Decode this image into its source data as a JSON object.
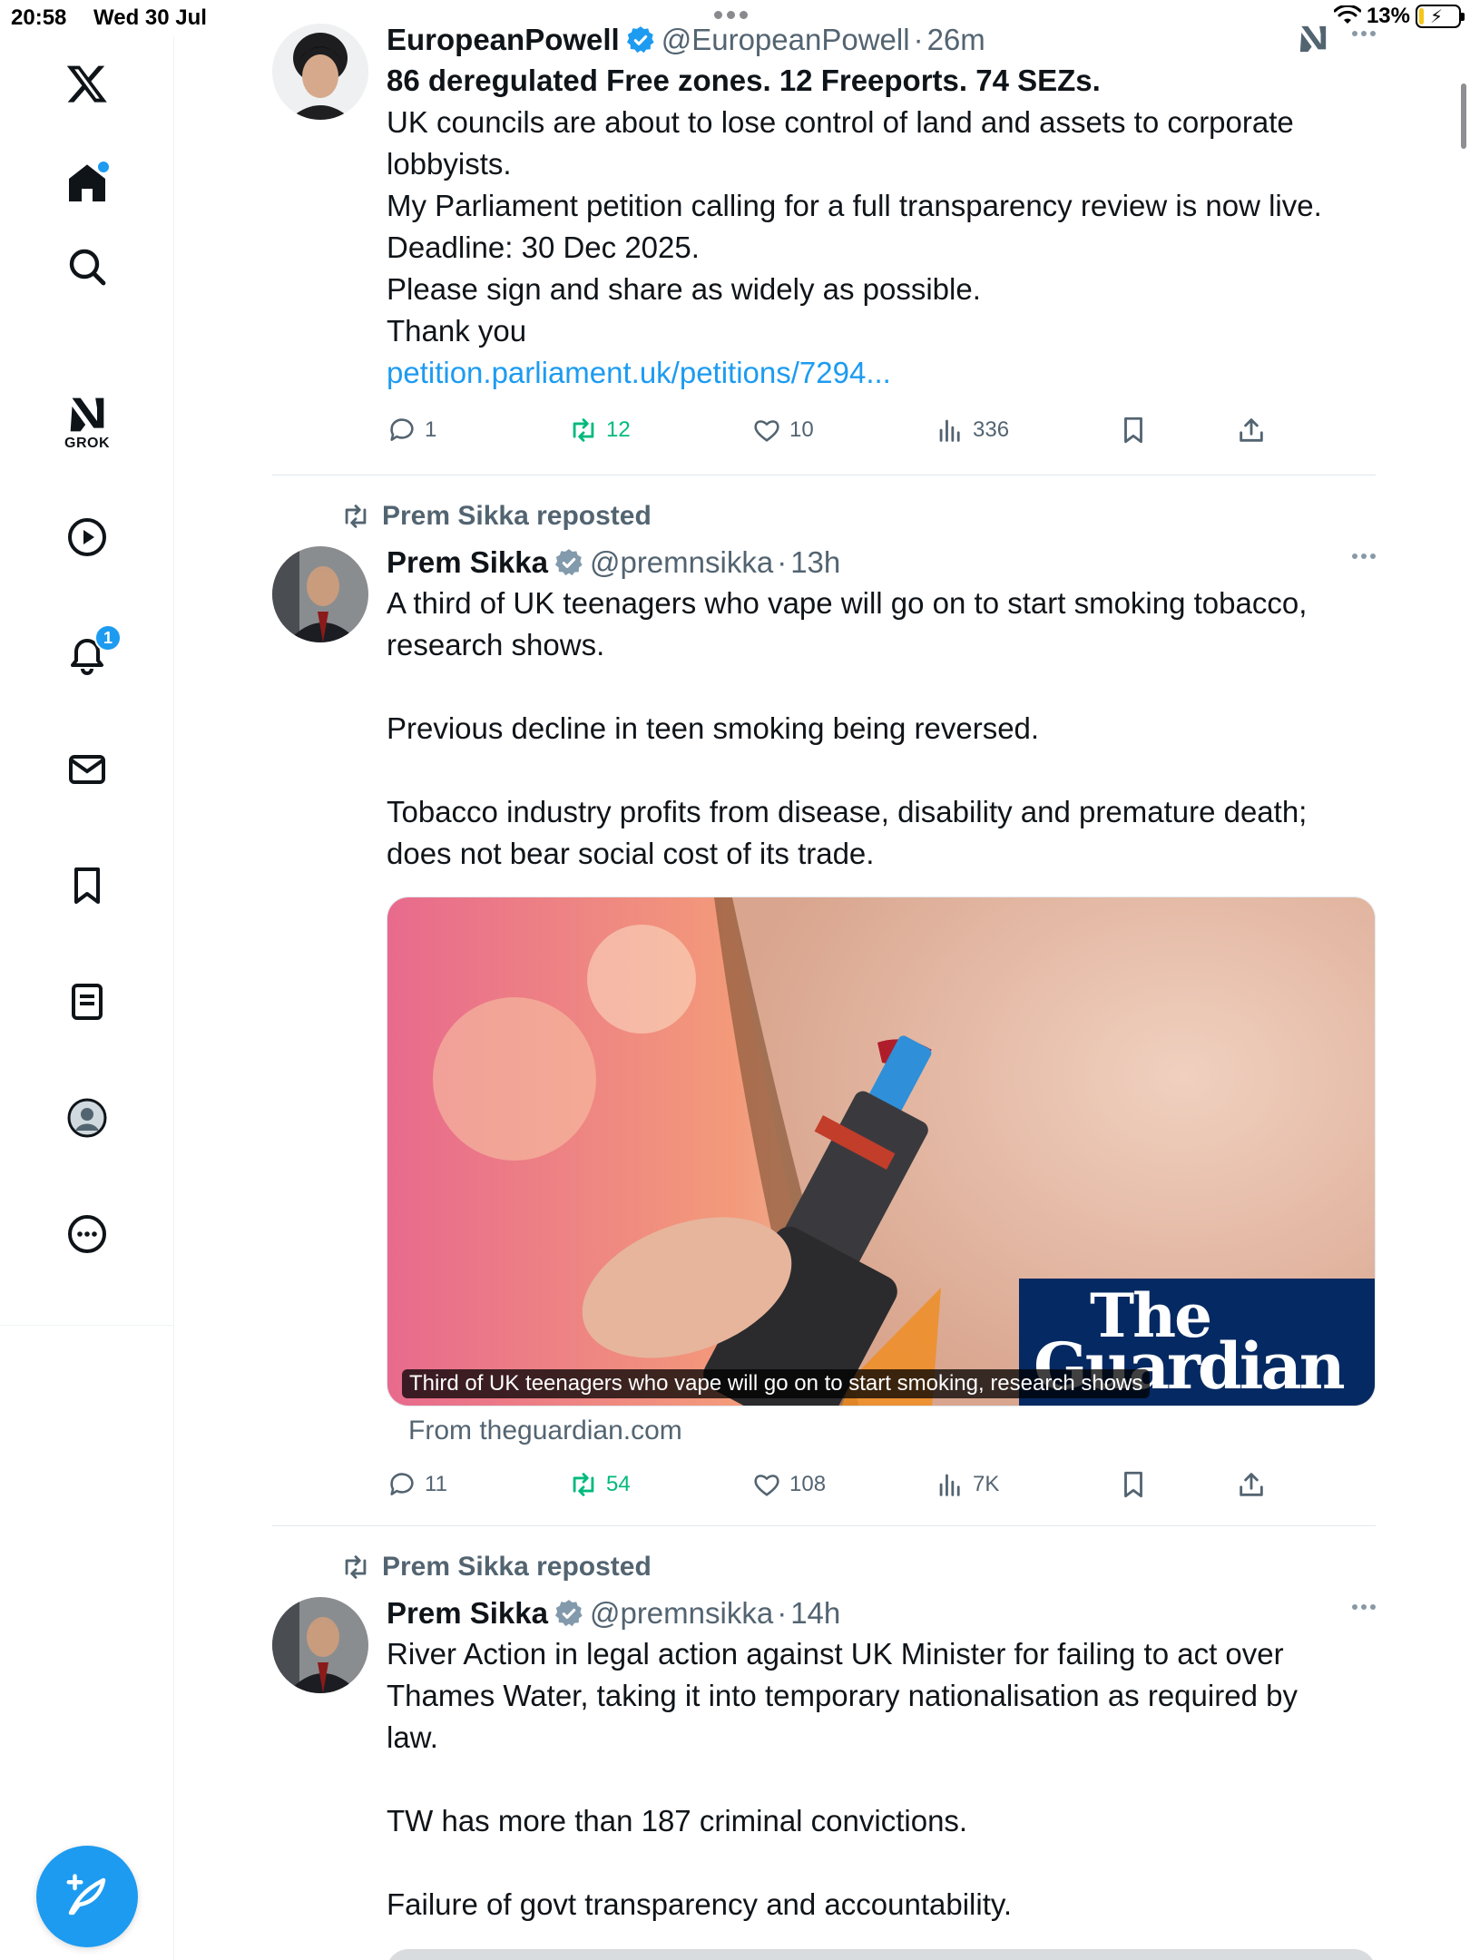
{
  "status_bar": {
    "time": "20:58",
    "date": "Wed 30 Jul",
    "battery_percent": "13%",
    "battery_level": 0.13
  },
  "sidebar": {
    "items": [
      {
        "name": "x-logo",
        "icon": "x-logo-icon"
      },
      {
        "name": "home",
        "icon": "home-icon",
        "has_dot": true
      },
      {
        "name": "search",
        "icon": "search-icon"
      },
      {
        "name": "grok",
        "icon": "grok-icon",
        "label": "GROK"
      },
      {
        "name": "video",
        "icon": "play-icon"
      },
      {
        "name": "notifications",
        "icon": "bell-icon",
        "badge": "1"
      },
      {
        "name": "messages",
        "icon": "mail-icon"
      },
      {
        "name": "bookmarks",
        "icon": "bookmark-icon"
      },
      {
        "name": "lists",
        "icon": "list-icon"
      },
      {
        "name": "profile",
        "icon": "profile-icon"
      },
      {
        "name": "more",
        "icon": "more-circle-icon"
      }
    ],
    "compose_icon": "compose-feather-icon"
  },
  "colors": {
    "accent": "#1d9bf0",
    "repost_green": "#00ba7c",
    "secondary_text": "#536471",
    "guardian_navy": "#052962"
  },
  "tweets": [
    {
      "name": "EuropeanPowell",
      "handle": "@EuropeanPowell",
      "time": "26m",
      "headline": "86 deregulated Free zones. 12 Freeports. 74 SEZs.",
      "lines": [
        "UK councils are about to lose control of land and assets to corporate",
        "lobbyists.",
        "My Parliament petition calling for a full transparency review is now live.",
        "Deadline: 30 Dec 2025.",
        "Please sign and share as widely as possible.",
        "Thank you"
      ],
      "link": "petition.parliament.uk/petitions/7294...",
      "replies": "1",
      "reposts": "12",
      "likes": "10",
      "views": "336"
    },
    {
      "repost_label": "Prem Sikka reposted",
      "name": "Prem Sikka",
      "handle": "@premnsikka",
      "time": "13h",
      "lines": [
        "A third of UK teenagers who vape will go on to start smoking tobacco,",
        "research shows.",
        "",
        "Previous decline in teen smoking being reversed.",
        "",
        "Tobacco industry profits from disease, disability and premature death;",
        "does not bear social cost of its trade."
      ],
      "card": {
        "caption": "Third of UK teenagers who vape will go on to start smoking, research shows",
        "logo_line1": "The",
        "logo_line2": "Guardian",
        "source": "From theguardian.com"
      },
      "replies": "11",
      "reposts": "54",
      "likes": "108",
      "views": "7K"
    },
    {
      "repost_label": "Prem Sikka reposted",
      "name": "Prem Sikka",
      "handle": "@premnsikka",
      "time": "14h",
      "lines": [
        "River Action in legal action against UK Minister for failing to act over",
        "Thames Water, taking it into temporary nationalisation as required by",
        "law.",
        "",
        "TW has more than 187 criminal convictions.",
        "",
        "Failure of govt transparency and accountability."
      ]
    }
  ]
}
